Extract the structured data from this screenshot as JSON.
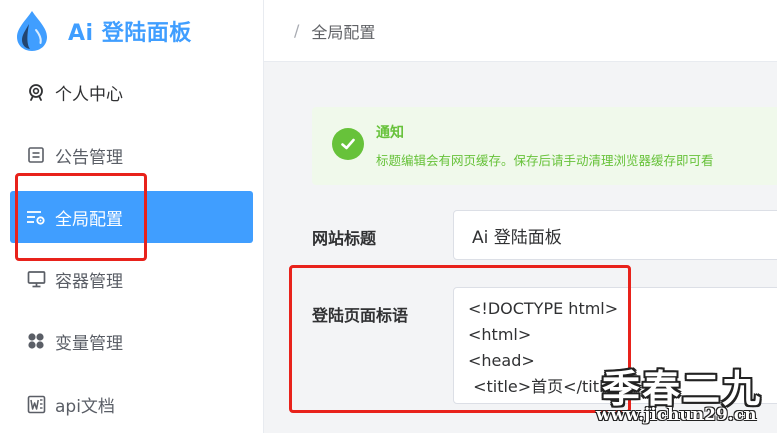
{
  "brand": {
    "title": "Ai 登陆面板",
    "logo_icon": "water-drop-icon",
    "accent_color": "#409eff"
  },
  "sidebar": {
    "items": [
      {
        "label": "个人中心",
        "icon": "user-circle-icon",
        "active": false
      },
      {
        "label": "公告管理",
        "icon": "notice-board-icon",
        "active": false
      },
      {
        "label": "全局配置",
        "icon": "settings-list-icon",
        "active": true
      },
      {
        "label": "容器管理",
        "icon": "monitor-icon",
        "active": false
      },
      {
        "label": "变量管理",
        "icon": "grid-dots-icon",
        "active": false
      },
      {
        "label": "api文档",
        "icon": "word-doc-icon",
        "active": false
      }
    ]
  },
  "breadcrumb": {
    "separator": "/",
    "current": "全局配置"
  },
  "alert": {
    "title": "通知",
    "description": "标题编辑会有网页缓存。保存后请手动清理浏览器缓存即可看",
    "icon": "check-circle-icon",
    "color": "#67c23a"
  },
  "form": {
    "site_title_label": "网站标题",
    "site_title_value": "Ai 登陆面板",
    "login_slogan_label": "登陆页面标语",
    "login_slogan_value": "<!DOCTYPE html>\n<html>\n<head>\n <title>首页</title>"
  },
  "watermark": {
    "text": "季春二九",
    "url": "www.jichun29.cn"
  },
  "highlight_color": "#e8221b"
}
